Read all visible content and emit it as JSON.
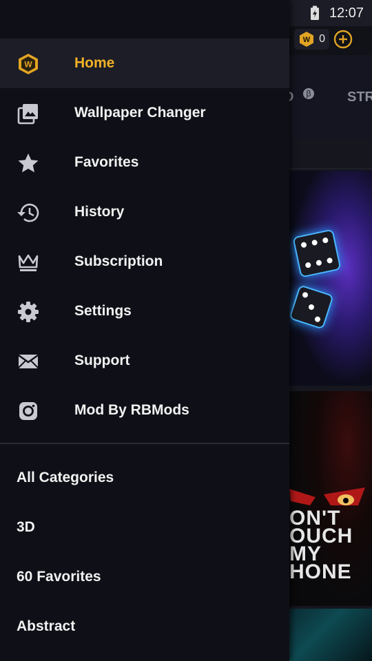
{
  "status_bar": {
    "time": "12:07"
  },
  "background_app": {
    "coin_count": "0",
    "tabs": [
      {
        "label": "D"
      },
      {
        "label": "STR"
      }
    ],
    "beta_badge": "β",
    "wallpaper_text": "ON'T\nOUCH\nMY\nHONE"
  },
  "drawer": {
    "menu": [
      {
        "label": "Home",
        "icon": "app-logo-icon",
        "active": true
      },
      {
        "label": "Wallpaper Changer",
        "icon": "wallpaper-changer-icon"
      },
      {
        "label": "Favorites",
        "icon": "star-icon"
      },
      {
        "label": "History",
        "icon": "history-icon"
      },
      {
        "label": "Subscription",
        "icon": "crown-icon"
      },
      {
        "label": "Settings",
        "icon": "gear-icon"
      },
      {
        "label": "Support",
        "icon": "mail-icon"
      },
      {
        "label": "Mod By RBMods",
        "icon": "instagram-icon"
      }
    ],
    "categories": [
      {
        "label": "All Categories"
      },
      {
        "label": "3D"
      },
      {
        "label": "60 Favorites"
      },
      {
        "label": "Abstract"
      }
    ]
  },
  "colors": {
    "accent": "#f2b227",
    "drawer_bg": "#0f1017",
    "active_bg": "#1c1d26"
  }
}
